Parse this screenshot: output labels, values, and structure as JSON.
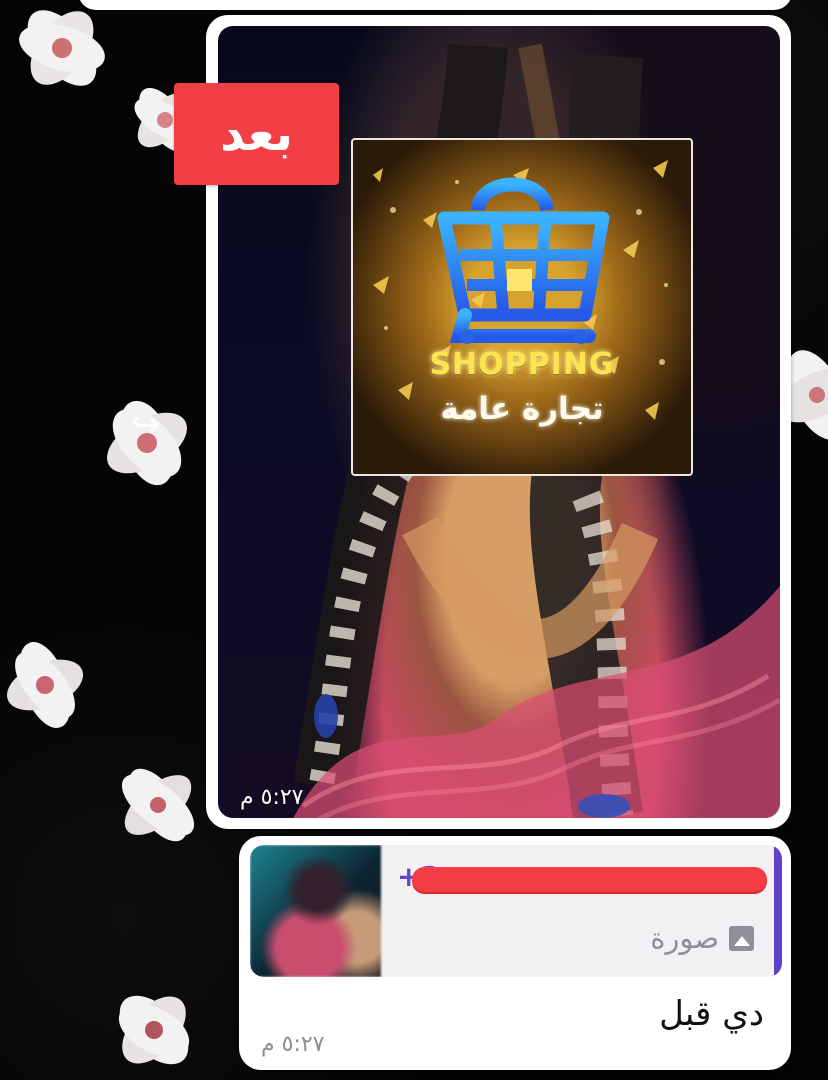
{
  "chat": {
    "image_message": {
      "label": "بعد",
      "time": "٥:٢٧ م",
      "card": {
        "title": "SHOPPING",
        "subtitle": "تجارة عامة"
      }
    },
    "reply_message": {
      "quoted": {
        "sender": "+2",
        "type": "صورة"
      },
      "text": "دي قبل",
      "time": "٥:٢٧ م"
    }
  },
  "icons": {
    "forward": "forward-arrow-icon",
    "photo": "image-icon",
    "cart": "shopping-cart-icon"
  },
  "colors": {
    "label_background": "#f13f43",
    "quote_sender": "#6146c6",
    "redaction": "#f43c44",
    "shop_text": "#ffe34d"
  }
}
